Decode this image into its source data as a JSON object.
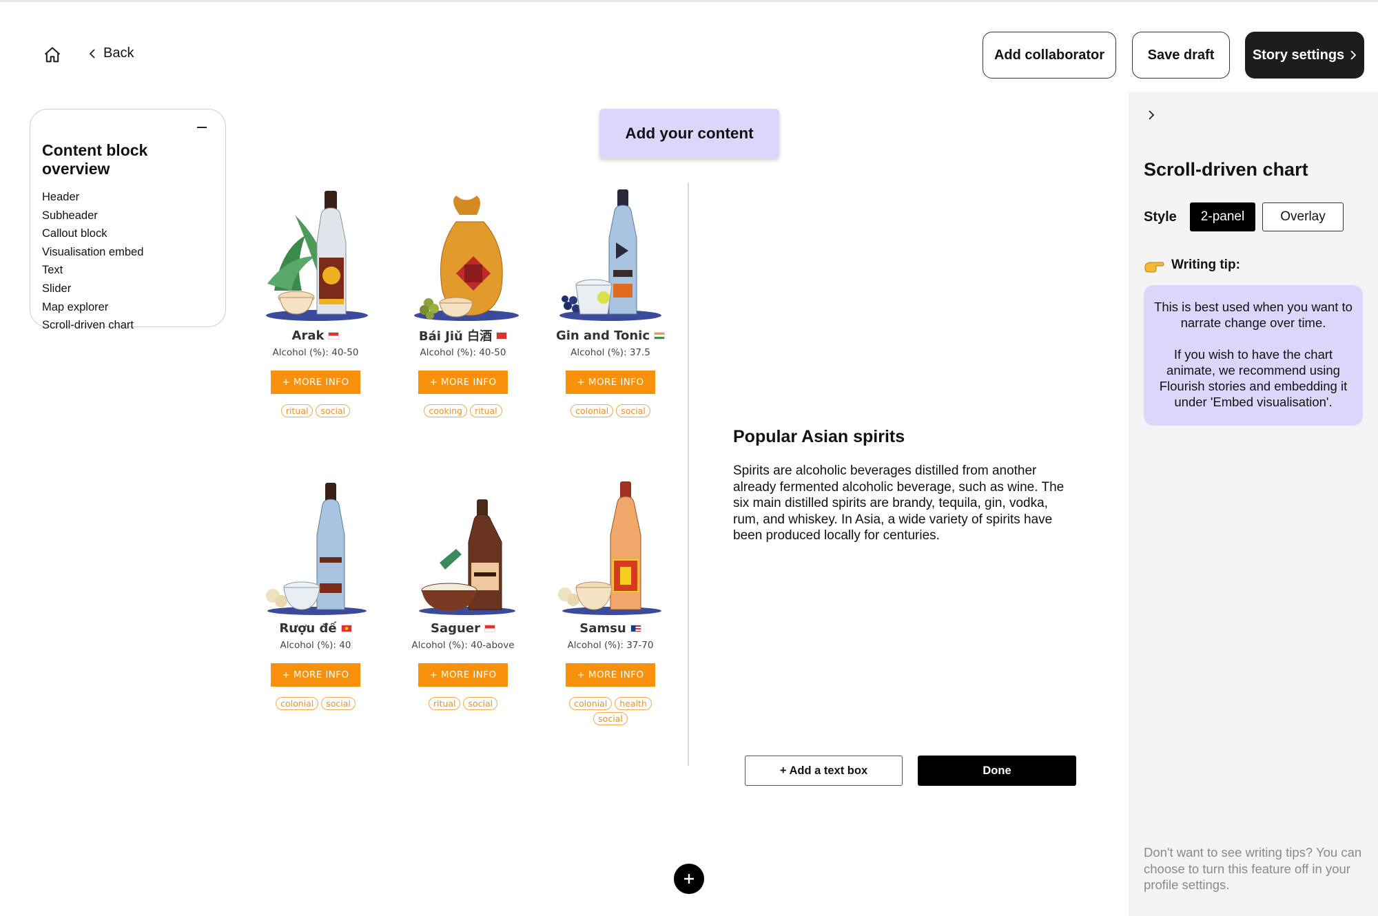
{
  "nav": {
    "back_label": "Back",
    "add_collaborator": "Add collaborator",
    "save_draft": "Save draft",
    "story_settings": "Story settings"
  },
  "overview": {
    "title": "Content block overview",
    "items": [
      "Header",
      "Subheader",
      "Callout block",
      "Visualisation embed",
      "Text",
      "Slider",
      "Map explorer",
      "Scroll-driven chart"
    ]
  },
  "add_content_label": "Add your content",
  "spirits": [
    {
      "name": "Arak",
      "abv": "Alcohol (%): 40-50",
      "more": "+ MORE INFO",
      "tags": [
        "ritual",
        "social"
      ],
      "flag_colors": [
        "#e03030",
        "#ffffff"
      ]
    },
    {
      "name": "Bái Jiǔ 白酒",
      "abv": "Alcohol (%): 40-50",
      "more": "+ MORE INFO",
      "tags": [
        "cooking",
        "ritual"
      ],
      "flag_colors": [
        "#e03030",
        "#e03030"
      ]
    },
    {
      "name": "Gin and Tonic",
      "abv": "Alcohol (%): 37.5",
      "more": "+ MORE INFO",
      "tags": [
        "colonial",
        "social"
      ],
      "flag_colors": [
        "#f39c33",
        "#2d9b42"
      ]
    },
    {
      "name": "Rượu đế",
      "abv": "Alcohol (%): 40",
      "more": "+ MORE INFO",
      "tags": [
        "colonial",
        "social"
      ],
      "flag_colors": [
        "#e03030",
        "#e03030"
      ]
    },
    {
      "name": "Saguer",
      "abv": "Alcohol (%): 40-above",
      "more": "+ MORE INFO",
      "tags": [
        "ritual",
        "social"
      ],
      "flag_colors": [
        "#e03030",
        "#ffffff"
      ]
    },
    {
      "name": "Samsu",
      "abv": "Alcohol (%): 37-70",
      "more": "+ MORE INFO",
      "tags": [
        "colonial",
        "health",
        "social"
      ],
      "flag_colors": [
        "#d03030",
        "#1a3a8a"
      ]
    }
  ],
  "text_panel": {
    "heading": "Popular Asian spirits",
    "body": "Spirits are alcoholic beverages distilled from another already fermented alcoholic beverage, such as wine. The six main distilled spirits are brandy, tequila, gin, vodka, rum, and whiskey. In Asia, a wide variety of spirits have been produced locally for centuries.",
    "add_text_box": "+ Add a text box",
    "done": "Done"
  },
  "sidebar": {
    "title": "Scroll-driven chart",
    "style_label": "Style",
    "style_options": [
      "2-panel",
      "Overlay"
    ],
    "tip_label": "Writing tip:",
    "tip_p1": "This is best used when you want to narrate change over time.",
    "tip_p2": "If you wish to have the chart animate, we recommend using Flourish stories and embedding it under 'Embed visualisation'.",
    "footer": "Don't want to see writing tips? You can choose to turn this feature off in your profile settings."
  },
  "colors": {
    "accent_lilac": "#ddd6fb",
    "more_info_orange": "#f7900a",
    "dark": "#1d1d1d"
  }
}
